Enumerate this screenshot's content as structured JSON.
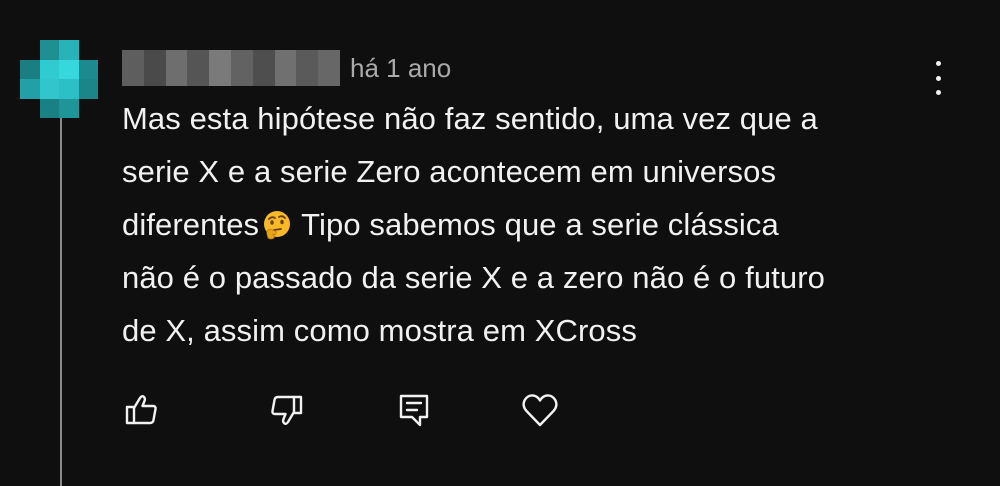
{
  "comment": {
    "avatar_colors": [
      "#1fa3a8",
      "#2bc3c9",
      "#34d4da",
      "#178a8e"
    ],
    "username_colors": [
      "#565656",
      "#6e6e6e",
      "#4d4d4d",
      "#7a7a7a",
      "#5e5e5e"
    ],
    "timestamp": "há 1 ano",
    "text_lines": [
      "Mas esta hipótese não faz sentido, uma vez que a",
      "serie X e a serie Zero acontecem em universos",
      "diferentes",
      "Tipo sabemos que a serie clássica",
      "não é o passado da serie X e a zero não é o futuro",
      "de X, assim como mostra em XCross"
    ],
    "emoji": "thinking-face",
    "more_actions_icon": "more-vert-icon"
  },
  "actions": [
    {
      "name": "like-button",
      "icon": "thumbs-up-icon"
    },
    {
      "name": "dislike-button",
      "icon": "thumbs-down-icon"
    },
    {
      "name": "reply-button",
      "icon": "reply-icon"
    },
    {
      "name": "heart-button",
      "icon": "heart-icon"
    }
  ],
  "theme": {
    "background": "#0f0f0f",
    "text": "#f1f1f1",
    "secondary_text": "#aaaaaa"
  }
}
